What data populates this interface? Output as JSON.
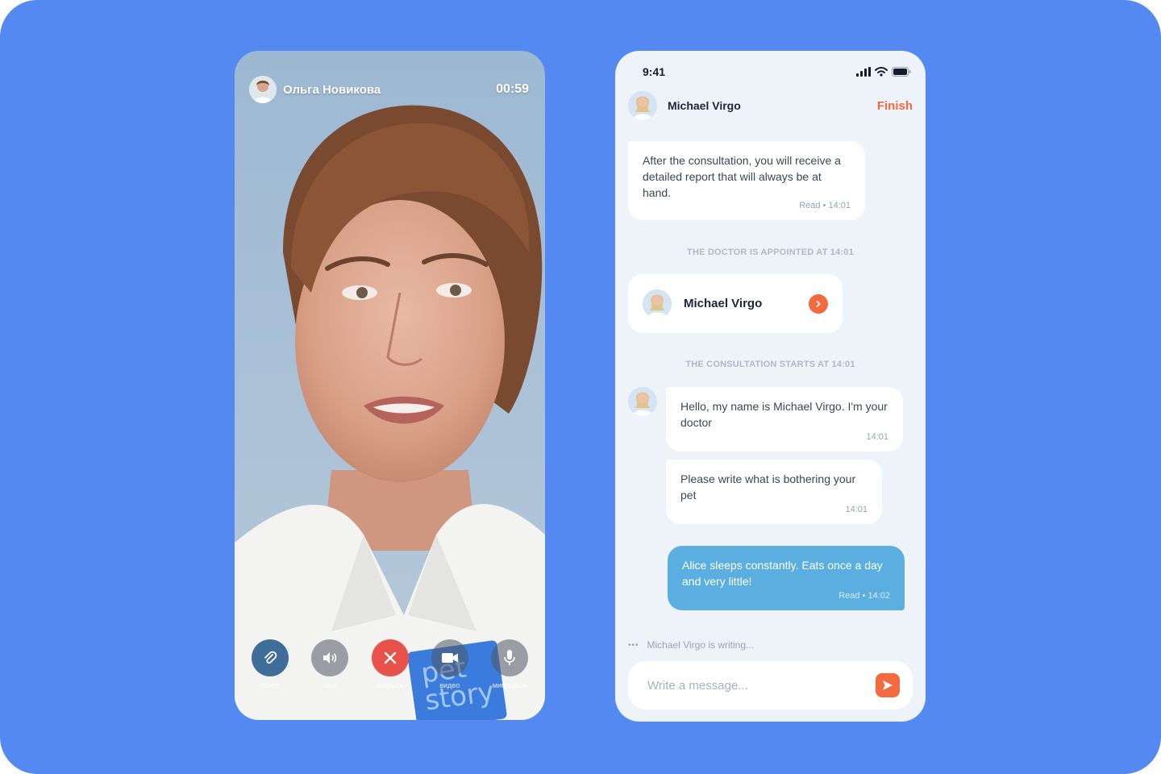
{
  "colors": {
    "background": "#5489f2",
    "accent": "#f26a3d",
    "outgoing_bubble": "#5aaee0",
    "end_call": "#e9524a"
  },
  "video_call": {
    "caller_name": "Ольга Новикова",
    "timer": "00:59",
    "badge_text": "pet story",
    "controls": [
      {
        "label": "фото",
        "icon": "paperclip-icon"
      },
      {
        "label": "звук",
        "icon": "speaker-icon"
      },
      {
        "label": "закрыть",
        "icon": "close-icon"
      },
      {
        "label": "видео",
        "icon": "video-camera-icon"
      },
      {
        "label": "микрофон",
        "icon": "microphone-icon"
      }
    ]
  },
  "chat": {
    "status_time": "9:41",
    "header": {
      "doctor_name": "Michael Virgo",
      "finish_label": "Finish"
    },
    "messages": [
      {
        "text": "After the consultation, you will receive a detailed report that will always be at hand.",
        "meta": "Read • 14:01"
      },
      {
        "text": "Hello, my name is Michael Virgo. I'm your doctor",
        "meta": "14:01"
      },
      {
        "text": "Please write what is bothering your pet",
        "meta": "14:01"
      },
      {
        "text": "Alice sleeps constantly. Eats once a day and very little!",
        "meta": "Read • 14:02"
      }
    ],
    "system": {
      "appointed": "THE DOCTOR IS APPOINTED AT 14:01",
      "starts": "THE CONSULTATION STARTS AT 14:01"
    },
    "doctor_card": {
      "name": "Michael Virgo"
    },
    "typing": "Michael Virgo is writing...",
    "input_placeholder": "Write a message..."
  }
}
